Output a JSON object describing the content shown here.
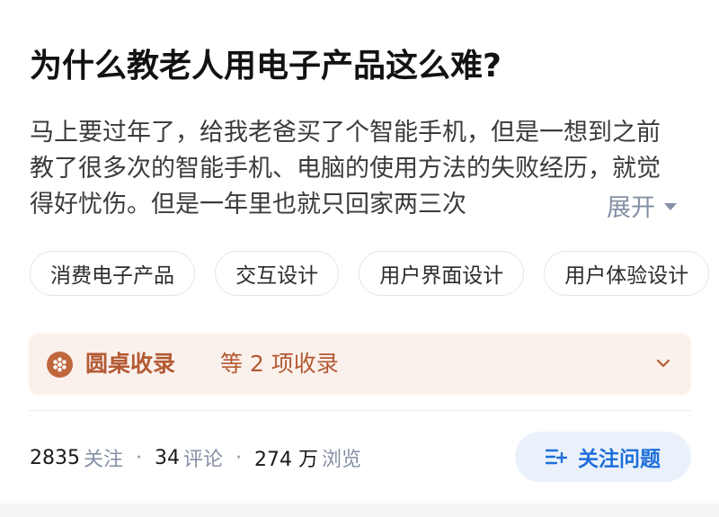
{
  "question": {
    "title": "为什么教老人用电子产品这么难?",
    "description": "马上要过年了，给我老爸买了个智能手机，但是一想到之前教了很多次的智能手机、电脑的使用方法的失败经历，就觉得好忧伤。但是一年里也就只回家两三次",
    "expand_label": "展开"
  },
  "tags": [
    "消费电子产品",
    "交互设计",
    "用户界面设计",
    "用户体验设计"
  ],
  "collection": {
    "name": "圆桌收录",
    "count_text": "等 2 项收录",
    "icon": "round-table-icon"
  },
  "stats": {
    "followers_num": "2835",
    "followers_label": "关注",
    "comments_num": "34",
    "comments_label": "评论",
    "views_num": "274 万",
    "views_label": "浏览",
    "separator": "·"
  },
  "actions": {
    "follow_label": "关注问题"
  },
  "colors": {
    "accent_blue": "#1e6fd9",
    "collection_brown": "#b35a33",
    "collection_bg": "#fbf1ec",
    "muted": "#8590a6"
  }
}
